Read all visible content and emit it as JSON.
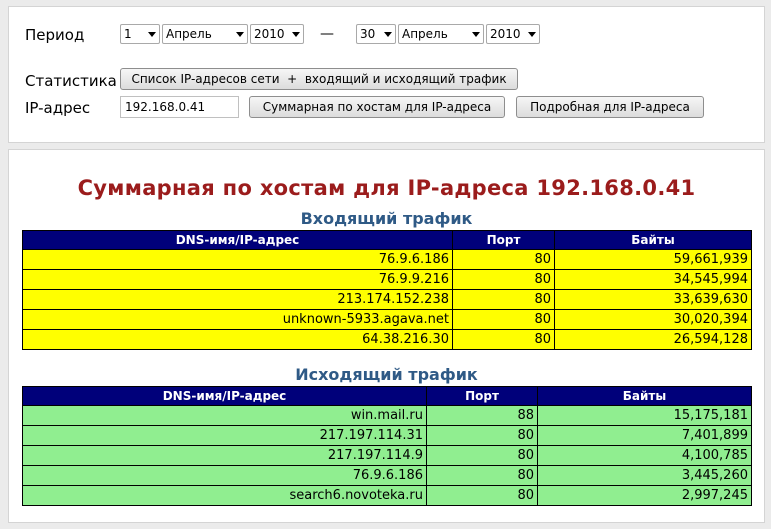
{
  "form": {
    "period_label": "Период",
    "from": {
      "day": "1",
      "month": "Апрель",
      "year": "2010"
    },
    "dash": "—",
    "to": {
      "day": "30",
      "month": "Апрель",
      "year": "2010"
    },
    "stats_label": "Статистика",
    "stats_button": "Список IP-адресов сети  +  входящий и исходящий трафик",
    "ip_label": "IP-адрес",
    "ip_value": "192.168.0.41",
    "summary_button": "Суммарная по хостам для IP-адреса",
    "detailed_button": "Подробная для IP-адреса"
  },
  "report": {
    "title": "Суммарная по хостам для IP-адреса 192.168.0.41",
    "columns": {
      "host": "DNS-имя/IP-адрес",
      "port": "Порт",
      "bytes": "Байты"
    },
    "incoming": {
      "title": "Входящий трафик",
      "rows": [
        {
          "host": "76.9.6.186",
          "port": "80",
          "bytes": "59,661,939"
        },
        {
          "host": "76.9.9.216",
          "port": "80",
          "bytes": "34,545,994"
        },
        {
          "host": "213.174.152.238",
          "port": "80",
          "bytes": "33,639,630"
        },
        {
          "host": "unknown-5933.agava.net",
          "port": "80",
          "bytes": "30,020,394"
        },
        {
          "host": "64.38.216.30",
          "port": "80",
          "bytes": "26,594,128"
        }
      ]
    },
    "outgoing": {
      "title": "Исходящий трафик",
      "rows": [
        {
          "host": "win.mail.ru",
          "port": "88",
          "bytes": "15,175,181"
        },
        {
          "host": "217.197.114.31",
          "port": "80",
          "bytes": "7,401,899"
        },
        {
          "host": "217.197.114.9",
          "port": "80",
          "bytes": "4,100,785"
        },
        {
          "host": "76.9.6.186",
          "port": "80",
          "bytes": "3,445,260"
        },
        {
          "host": "search6.novoteka.ru",
          "port": "80",
          "bytes": "2,997,245"
        }
      ]
    }
  },
  "colors": {
    "header_bg": "#00007a",
    "incoming_row": "#ffff00",
    "outgoing_row": "#90ee90",
    "title": "#9b1c1c",
    "section_title": "#2f5a86"
  }
}
